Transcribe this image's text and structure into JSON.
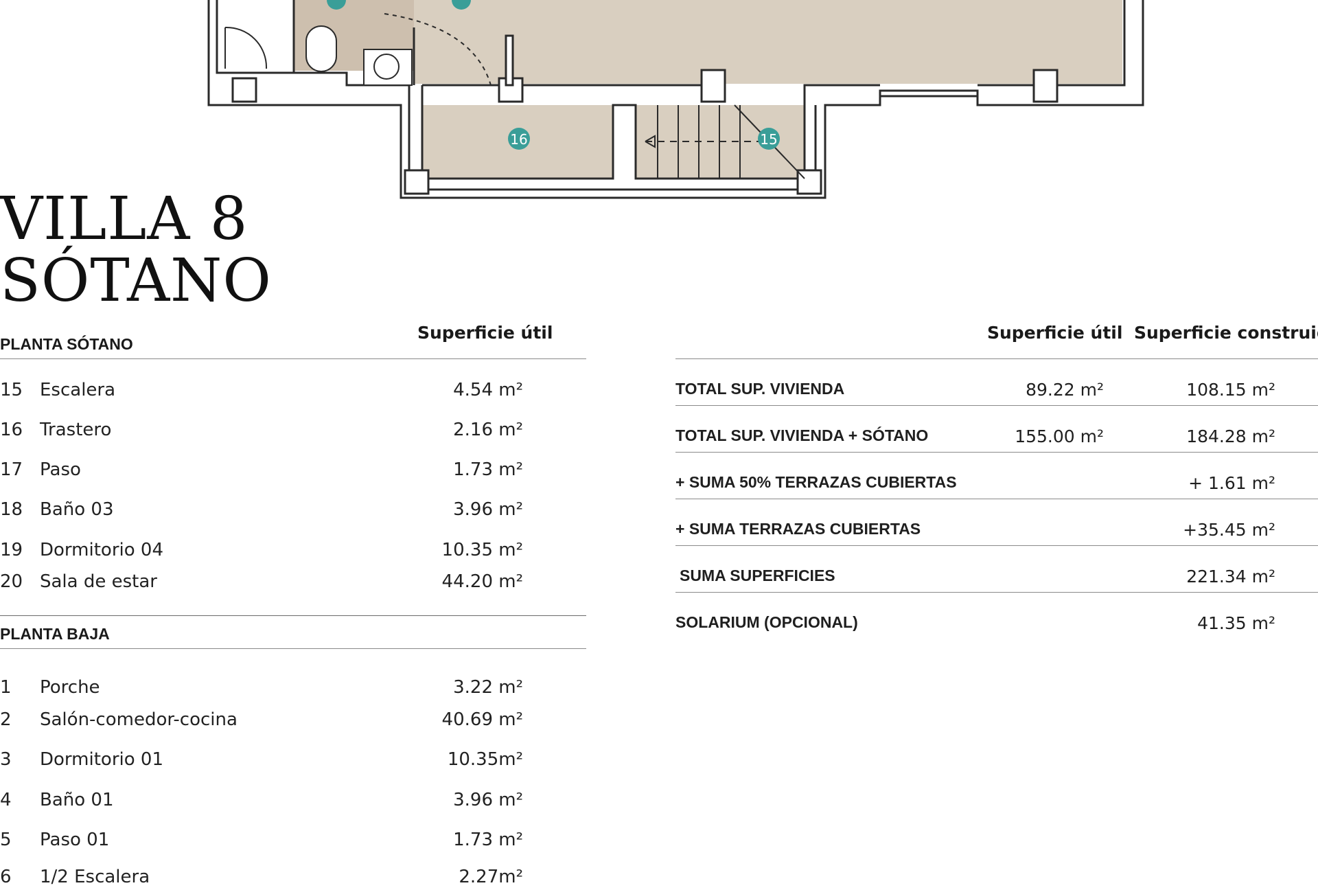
{
  "title": {
    "line1": "VILLA 8",
    "line2": "SÓTANO"
  },
  "plan": {
    "room_markers": [
      {
        "label": "16"
      },
      {
        "label": "15"
      }
    ],
    "colors": {
      "floor": "#d9cfc0",
      "marker": "#3a9e98",
      "wall": "#2a2a2a"
    }
  },
  "basement": {
    "heading": "PLANTA SÓTANO",
    "col_header": "Superficie útil",
    "rows": [
      {
        "num": "15",
        "name": "Escalera",
        "area": "4.54 m²"
      },
      {
        "num": "16",
        "name": "Trastero",
        "area": "2.16 m²"
      },
      {
        "num": "17",
        "name": "Paso",
        "area": "1.73 m²"
      },
      {
        "num": "18",
        "name": "Baño 03",
        "area": "3.96 m²"
      },
      {
        "num": "19",
        "name": "Dormitorio 04",
        "area": "10.35 m²"
      },
      {
        "num": "20",
        "name": "Sala de estar",
        "area": "44.20 m²"
      }
    ]
  },
  "ground": {
    "heading": "PLANTA BAJA",
    "rows": [
      {
        "num": "1",
        "name": "Porche",
        "area": "3.22 m²"
      },
      {
        "num": "2",
        "name": "Salón-comedor-cocina",
        "area": "40.69 m²"
      },
      {
        "num": "3",
        "name": "Dormitorio 01",
        "area": "10.35m²"
      },
      {
        "num": "4",
        "name": "Baño 01",
        "area": "3.96 m²"
      },
      {
        "num": "5",
        "name": "Paso 01",
        "area": "1.73 m²"
      },
      {
        "num": "6",
        "name": "1/2 Escalera",
        "area": "2.27m²"
      }
    ]
  },
  "totals": {
    "col_util": "Superficie útil",
    "col_construida": "Superficie construida",
    "rows": [
      {
        "label": "TOTAL SUP. VIVIENDA",
        "util": "89.22 m²",
        "construida": "108.15 m²"
      },
      {
        "label": "TOTAL SUP. VIVIENDA + SÓTANO",
        "util": "155.00  m²",
        "construida": "184.28 m²"
      },
      {
        "label": "+ SUMA 50% TERRAZAS CUBIERTAS",
        "util": "",
        "construida": "+ 1.61 m²"
      },
      {
        "label": "+ SUMA TERRAZAS CUBIERTAS",
        "util": "",
        "construida": "+35.45 m²"
      },
      {
        "label": "SUMA SUPERFICIES",
        "util": "",
        "construida": "221.34 m²"
      },
      {
        "label": "SOLARIUM (OPCIONAL)",
        "util": "",
        "construida": "41.35 m²"
      }
    ]
  }
}
